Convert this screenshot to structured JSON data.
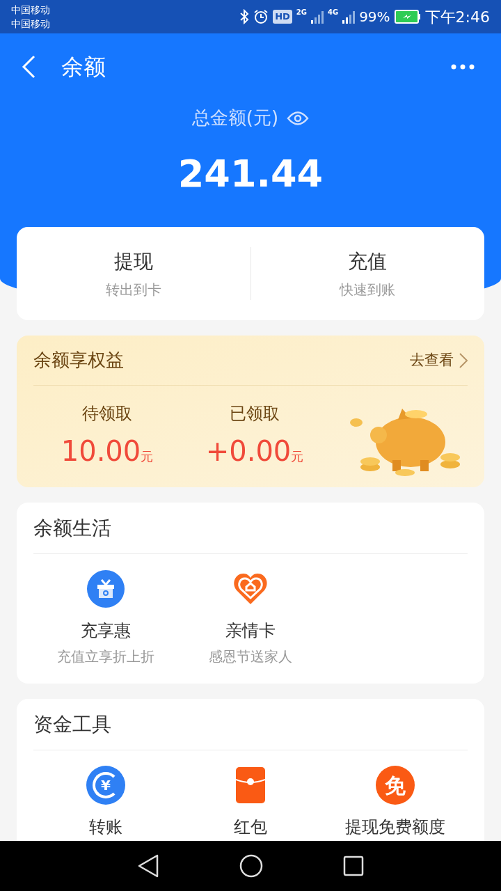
{
  "status_bar": {
    "carriers": [
      "中国移动",
      "中国移动"
    ],
    "hd": "HD",
    "net_1": "2G",
    "net_2": "4G",
    "battery": "99%",
    "time": "下午2:46"
  },
  "header": {
    "title": "余额",
    "total_label": "总金额(元)",
    "total": "241.44"
  },
  "actions": [
    {
      "title": "提现",
      "subtitle": "转出到卡"
    },
    {
      "title": "充值",
      "subtitle": "快速到账"
    }
  ],
  "rights": {
    "title": "余额享权益",
    "link": "去查看",
    "stats": [
      {
        "label": "待领取",
        "amount": "10.00",
        "unit": "元"
      },
      {
        "label": "已领取",
        "amount": "+0.00",
        "unit": "元"
      }
    ]
  },
  "sections": [
    {
      "title": "余额生活",
      "items": [
        {
          "kind": "gift",
          "label": "充享惠",
          "subtitle": "充值立享折上折"
        },
        {
          "kind": "heart",
          "label": "亲情卡",
          "subtitle": "感恩节送家人"
        }
      ]
    },
    {
      "title": "资金工具",
      "items": [
        {
          "kind": "transfer",
          "glyph": "¥",
          "label": "转账"
        },
        {
          "kind": "envelope",
          "label": "红包"
        },
        {
          "kind": "free",
          "glyph": "免",
          "label": "提现免费额度"
        }
      ]
    }
  ]
}
